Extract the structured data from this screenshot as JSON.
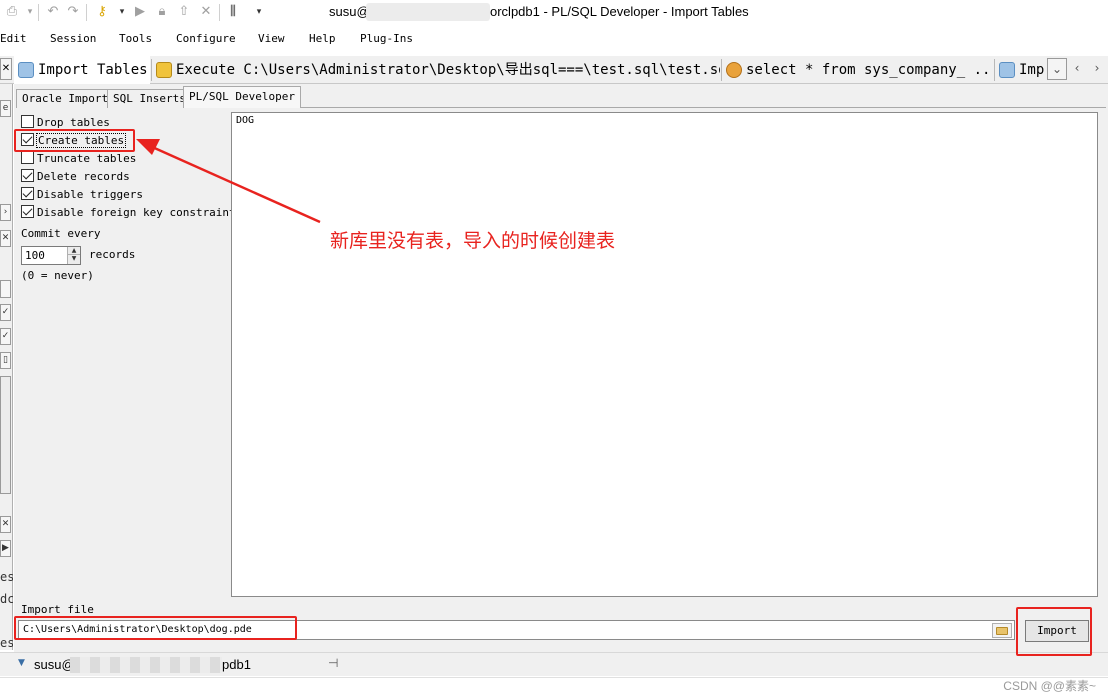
{
  "window": {
    "title_prefix": "susu@",
    "title_suffix": "orclpdb1 - PL/SQL Developer - Import Tables"
  },
  "menu": [
    "Edit",
    "Session",
    "Tools",
    "Configure",
    "View",
    "Help",
    "Plug-Ins"
  ],
  "doc_tabs": [
    {
      "label": "Import Tables",
      "icon": "import-icon",
      "active": true
    },
    {
      "label": "Execute C:\\Users\\Administrator\\Desktop\\导出sql===\\test.sql\\test.sql",
      "icon": "script-icon",
      "active": false
    },
    {
      "label": "select * from sys_company_ ...",
      "icon": "sql-window-icon",
      "active": false
    },
    {
      "label": "Imp",
      "icon": "import-icon",
      "active": false
    }
  ],
  "sub_tabs": [
    "Oracle Import",
    "SQL Inserts",
    "PL/SQL Developer"
  ],
  "options": [
    {
      "label": "Drop tables",
      "checked": false
    },
    {
      "label": "Create tables",
      "checked": true
    },
    {
      "label": "Truncate tables",
      "checked": false
    },
    {
      "label": "Delete records",
      "checked": true
    },
    {
      "label": "Disable triggers",
      "checked": true
    },
    {
      "label": "Disable foreign key constraints",
      "checked": true
    }
  ],
  "commit": {
    "label": "Commit every",
    "value": "100",
    "unit": "records",
    "note": "(0 = never)"
  },
  "tables_text": "DOG",
  "import_file": {
    "label": "Import file",
    "value": "C:\\Users\\Administrator\\Desktop\\dog.pde"
  },
  "import_button": "Import",
  "status": {
    "prefix": "susu@",
    "suffix": "pdb1"
  },
  "annotation": {
    "text": "新库里没有表，导入的时候创建表",
    "color": "#e8231f"
  },
  "watermark": "CSDN @@素素~"
}
